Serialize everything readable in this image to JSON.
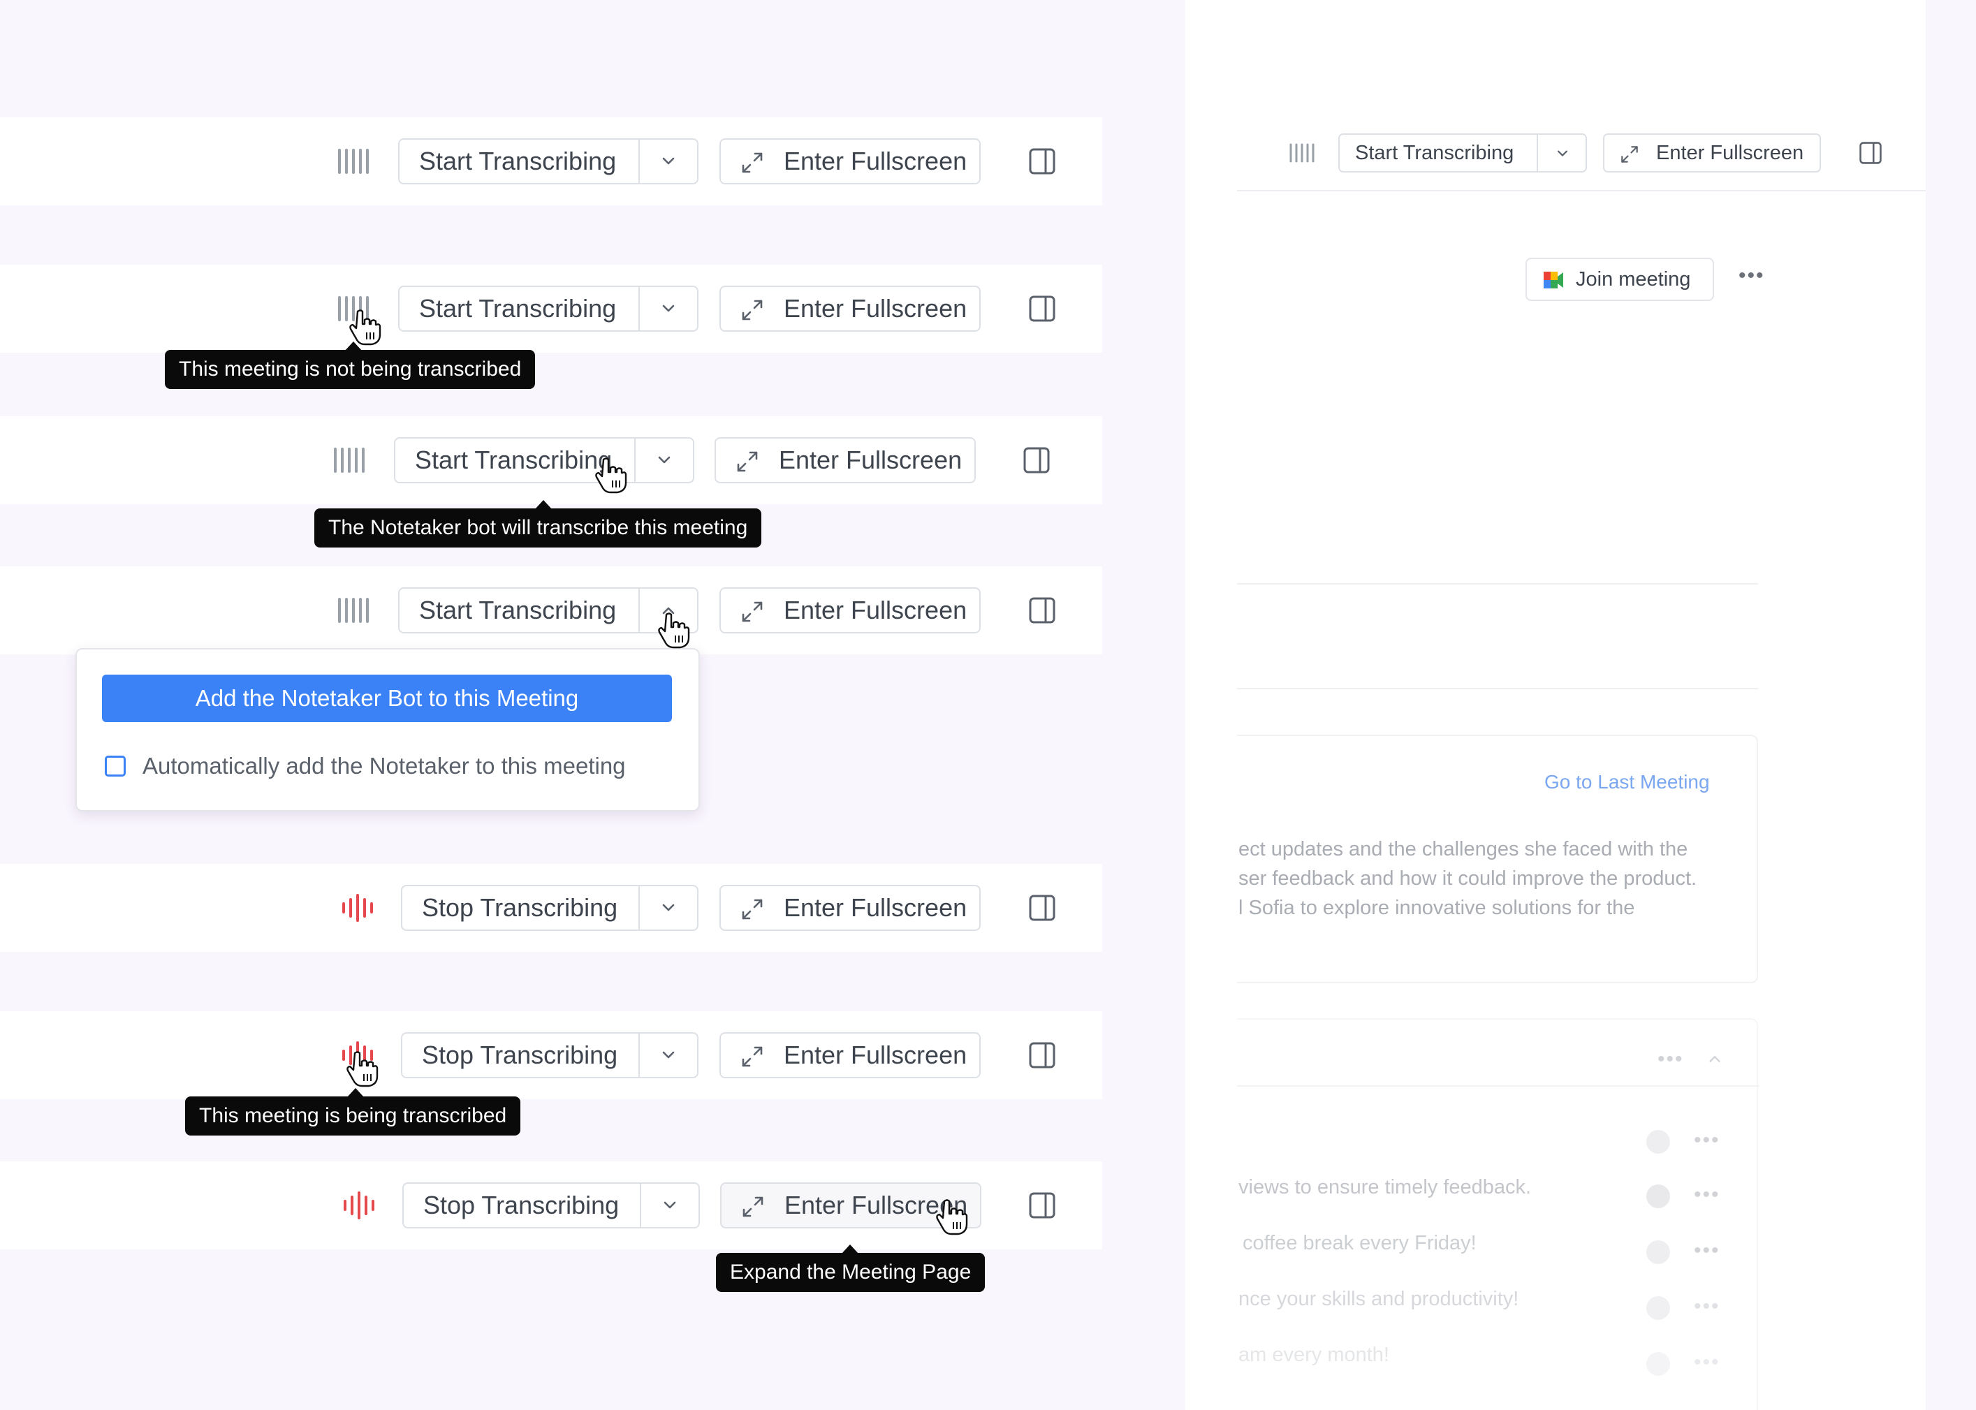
{
  "rows": [
    {
      "button": "Start Transcribing",
      "fullscreen": "Enter Fullscreen"
    },
    {
      "button": "Start Transcribing",
      "fullscreen": "Enter Fullscreen"
    },
    {
      "button": "Start Transcribing",
      "fullscreen": "Enter Fullscreen"
    },
    {
      "button": "Start Transcribing",
      "fullscreen": "Enter Fullscreen"
    },
    {
      "button": "Stop Transcribing",
      "fullscreen": "Enter Fullscreen"
    },
    {
      "button": "Stop Transcribing",
      "fullscreen": "Enter Fullscreen"
    },
    {
      "button": "Stop Transcribing",
      "fullscreen": "Enter Fullscreen"
    }
  ],
  "tooltips": {
    "not_transcribed": "This meeting is not being transcribed",
    "bot_will_transcribe": "The Notetaker bot will transcribe this meeting",
    "being_transcribed": "This meeting is being transcribed",
    "expand_page": "Expand the Meeting Page"
  },
  "dropdown": {
    "primary_action": "Add the Notetaker Bot to this Meeting",
    "checkbox_label": "Automatically add the Notetaker to this meeting",
    "checkbox_checked": false
  },
  "meeting_page": {
    "toolbar": {
      "button": "Start Transcribing",
      "fullscreen": "Enter Fullscreen"
    },
    "join_meeting": "Join meeting",
    "go_to_last_meeting": "Go to Last Meeting",
    "summary_lines": [
      "ect updates and the challenges she faced with the",
      "ser feedback and how it could improve the product.",
      "l Sofia to explore innovative solutions for the"
    ],
    "list_items": [
      "views to ensure timely feedback.",
      "coffee break every Friday!",
      "nce your skills and productivity!",
      "am every month!"
    ]
  },
  "colors": {
    "accent": "#3b82f6",
    "recording": "#e5484d",
    "idle_wave": "#9aa0a8",
    "tooltip_bg": "#0a0a0a",
    "page_bg": "#faf6fe",
    "link": "#7aa7ef"
  }
}
